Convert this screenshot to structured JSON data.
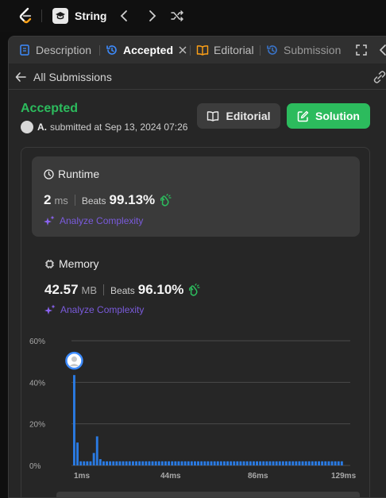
{
  "header": {
    "problem_title": "String"
  },
  "tabs": {
    "description": "Description",
    "accepted": "Accepted",
    "editorial": "Editorial",
    "submissions": "Submission"
  },
  "back": {
    "label": "All Submissions"
  },
  "submission": {
    "status": "Accepted",
    "user": "A.",
    "submitted_text": "submitted at Sep 13, 2024 07:26"
  },
  "buttons": {
    "editorial": "Editorial",
    "solution": "Solution"
  },
  "runtime": {
    "title": "Runtime",
    "value": "2",
    "unit": "ms",
    "beats_label": "Beats",
    "beats_pct": "99.13%",
    "analyze": "Analyze Complexity"
  },
  "memory": {
    "title": "Memory",
    "value": "42.57",
    "unit": "MB",
    "beats_label": "Beats",
    "beats_pct": "96.10%",
    "analyze": "Analyze Complexity"
  },
  "colors": {
    "accent_green": "#2cbb5d",
    "bar_blue": "#2a7ae2",
    "analyze_purple": "#7a5bdc"
  },
  "chart_data": {
    "type": "bar",
    "y_tick_labels": [
      "60%",
      "40%",
      "20%",
      "0%"
    ],
    "x_tick_labels": [
      "1ms",
      "44ms",
      "86ms",
      "129ms"
    ],
    "ylim": [
      0,
      60
    ],
    "grid": true,
    "highlighted_bin": 0,
    "values": [
      43.5,
      11.0,
      2.0,
      2.0,
      2.0,
      2.0,
      6.0,
      14.0,
      3.0,
      2.0,
      2.0,
      2.0,
      2.0,
      2.0,
      2.0,
      2.0,
      2.0,
      2.0,
      2.0,
      2.0,
      2.0,
      2.0,
      2.0,
      2.0,
      2.0,
      2.0,
      2.0,
      2.0,
      2.0,
      2.0,
      2.0,
      2.0,
      2.0,
      2.0,
      2.0,
      2.0,
      2.0,
      2.0,
      2.0,
      2.0,
      2.0,
      2.0,
      2.0,
      2.0,
      2.0,
      2.0,
      2.0,
      2.0,
      2.0,
      2.0,
      2.0,
      2.0,
      2.0,
      2.0,
      2.0,
      2.0,
      2.0,
      2.0,
      2.0,
      2.0,
      2.0,
      2.0,
      2.0,
      2.0,
      2.0,
      2.0,
      2.0,
      2.0,
      2.0,
      2.0,
      2.0,
      2.0,
      2.0,
      2.0,
      2.0,
      2.0,
      2.0,
      2.0,
      2.0,
      2.0,
      2.0,
      2.0,
      2.0
    ]
  }
}
